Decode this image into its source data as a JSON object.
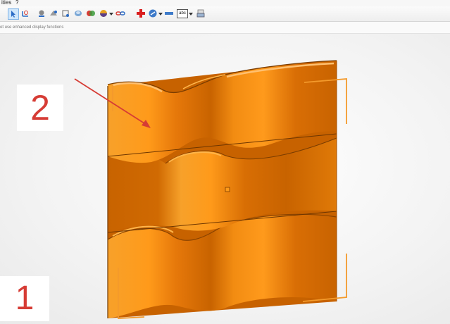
{
  "menubar": {
    "items": [
      "ities",
      "?"
    ]
  },
  "toolbar": {
    "icons": [
      "select-arrow-icon",
      "rotate-view-icon",
      "render-sphere-icon",
      "shaded-view-icon",
      "wireframe-view-icon",
      "material-icon",
      "color-icon",
      "texture-ball-icon",
      "link-icon",
      "add-cross-icon",
      "measure-icon",
      "line-tool-icon",
      "text-abc-icon",
      "print-icon"
    ],
    "text_abc": "abc"
  },
  "statusline": {
    "text": "ot use enhanced display functions"
  },
  "callouts": {
    "label_2": "2",
    "label_1": "1"
  },
  "colors": {
    "model_orange": "#f28c12",
    "model_shadow": "#c25f00",
    "callout_red": "#d63c35",
    "bounding_box": "#f39a2c"
  }
}
